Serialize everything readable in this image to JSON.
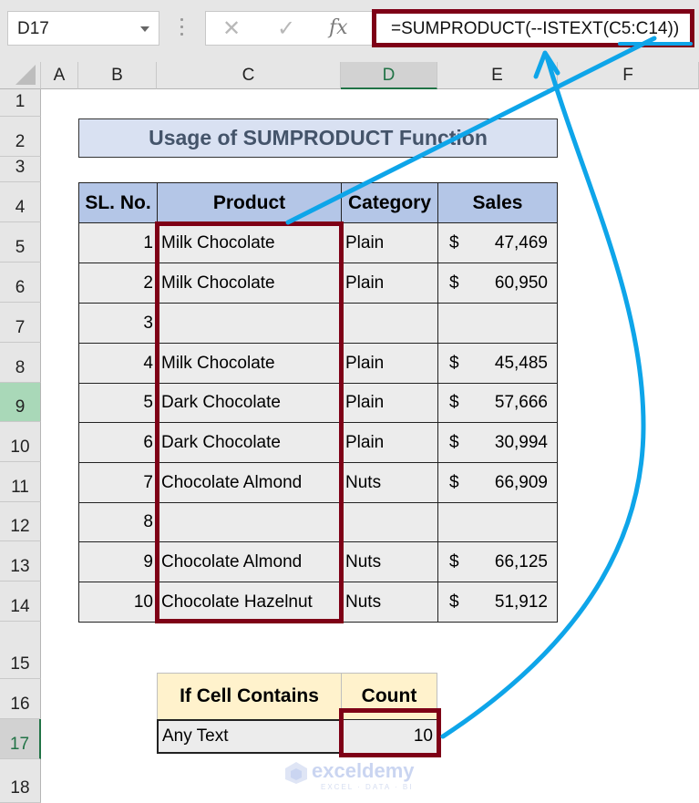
{
  "formula_bar": {
    "name_box": "D17",
    "cancel_icon": "✕",
    "enter_icon": "✓",
    "fx_label": "fx",
    "formula": "=SUMPRODUCT(--ISTEXT(C5:C14))"
  },
  "columns": [
    "A",
    "B",
    "C",
    "D",
    "E",
    "F"
  ],
  "selected_column": "D",
  "rows": [
    "1",
    "2",
    "3",
    "4",
    "5",
    "6",
    "7",
    "8",
    "9",
    "10",
    "11",
    "12",
    "13",
    "14",
    "15",
    "16",
    "17",
    "18"
  ],
  "selected_row": "17",
  "highlighted_row": "9",
  "title": "Usage of SUMPRODUCT Function",
  "table": {
    "headers": [
      "SL. No.",
      "Product",
      "Category",
      "Sales"
    ],
    "currency_symbol": "$",
    "rows": [
      {
        "sl": "1",
        "product": "Milk Chocolate",
        "category": "Plain",
        "sales": "47,469"
      },
      {
        "sl": "2",
        "product": "Milk Chocolate",
        "category": "Plain",
        "sales": "60,950"
      },
      {
        "sl": "3",
        "product": "",
        "category": "",
        "sales": ""
      },
      {
        "sl": "4",
        "product": "Milk Chocolate",
        "category": "Plain",
        "sales": "45,485"
      },
      {
        "sl": "5",
        "product": "Dark Chocolate",
        "category": "Plain",
        "sales": "57,666"
      },
      {
        "sl": "6",
        "product": "Dark Chocolate",
        "category": "Plain",
        "sales": "30,994"
      },
      {
        "sl": "7",
        "product": "Chocolate Almond",
        "category": "Nuts",
        "sales": "66,909"
      },
      {
        "sl": "8",
        "product": "",
        "category": "",
        "sales": ""
      },
      {
        "sl": "9",
        "product": "Chocolate Almond",
        "category": "Nuts",
        "sales": "66,125"
      },
      {
        "sl": "10",
        "product": "Chocolate Hazelnut",
        "category": "Nuts",
        "sales": "51,912"
      }
    ]
  },
  "result_table": {
    "headers": [
      "If Cell Contains",
      "Count"
    ],
    "criteria": "Any Text",
    "count": "10"
  },
  "annotation_colors": {
    "highlight_box": "#7e0016",
    "arrow": "#0ea5e9"
  },
  "watermark": {
    "name": "exceldemy",
    "tagline": "EXCEL · DATA · BI"
  }
}
